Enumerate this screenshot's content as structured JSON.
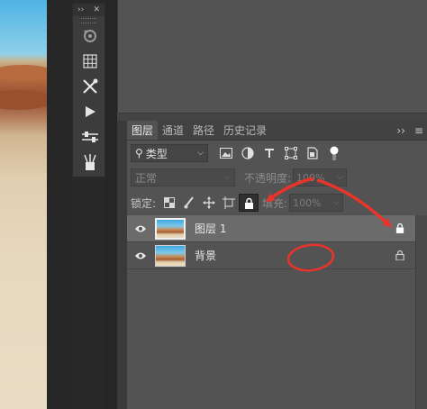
{
  "tool_strip": {
    "collapse_label": "››",
    "close_label": "✕",
    "tools": [
      "three-d-icon",
      "grid-icon",
      "tools-brush-icon",
      "play-icon",
      "adjust-sliders-icon",
      "brush-presets-icon"
    ]
  },
  "layers_panel": {
    "tabs": [
      {
        "label": "图层",
        "active": true
      },
      {
        "label": "通道",
        "active": false
      },
      {
        "label": "路径",
        "active": false
      },
      {
        "label": "历史记录",
        "active": false
      }
    ],
    "expand_label": "››",
    "menu_label": "≡",
    "filter": {
      "search_symbol": "⚲",
      "kind_label": "类型",
      "caret": "⌵"
    },
    "blend": {
      "mode": "正常",
      "caret": "⌵",
      "opacity_label": "不透明度:",
      "opacity_value": "100%",
      "opacity_caret": "⌵"
    },
    "lock": {
      "label": "锁定:",
      "fill_label": "填充:",
      "fill_value": "100%",
      "fill_caret": "⌵"
    },
    "layers": [
      {
        "name": "图层 1",
        "visible": true,
        "selected": true,
        "locked": true
      },
      {
        "name": "背景",
        "visible": true,
        "selected": false,
        "locked": true
      }
    ]
  },
  "colors": {
    "panel_bg": "#535353",
    "selected_row": "#6b6b6b",
    "annotation_red": "#e8342b"
  }
}
